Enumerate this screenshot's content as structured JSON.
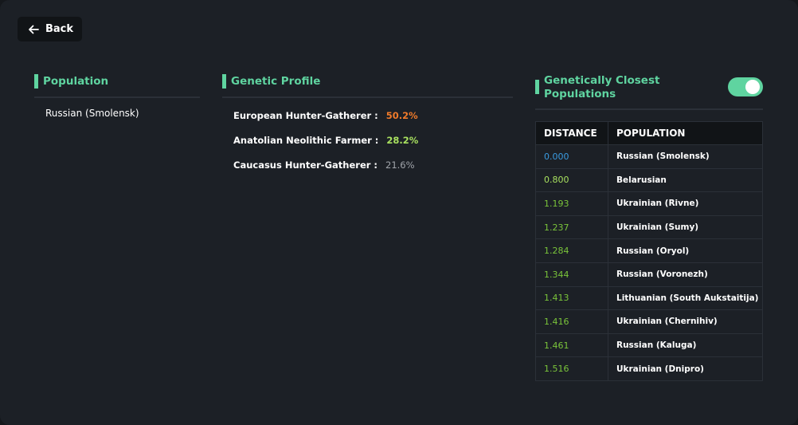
{
  "back_button": {
    "label": "Back",
    "icon": "arrow-left-icon"
  },
  "population_section": {
    "title": "Population",
    "value": "Russian (Smolensk)"
  },
  "genetic_profile": {
    "title": "Genetic Profile",
    "components": [
      {
        "label": "European Hunter-Gatherer :",
        "value": "50.2%",
        "color": "#f07a2a"
      },
      {
        "label": "Anatolian Neolithic Farmer :",
        "value": "28.2%",
        "color": "#a8e05f"
      },
      {
        "label": "Caucasus Hunter-Gatherer :",
        "value": "21.6%",
        "color": "#a0a4aa"
      }
    ]
  },
  "closest_populations": {
    "title": "Genetically Closest Populations",
    "toggle_on": true,
    "columns": [
      "DISTANCE",
      "POPULATION"
    ],
    "rows": [
      {
        "distance": "0.000",
        "population": "Russian (Smolensk)",
        "color": "#3a9be0"
      },
      {
        "distance": "0.800",
        "population": "Belarusian",
        "color": "#a8e05f"
      },
      {
        "distance": "1.193",
        "population": "Ukrainian (Rivne)",
        "color": "#7ac43a"
      },
      {
        "distance": "1.237",
        "population": "Ukrainian (Sumy)",
        "color": "#7ac43a"
      },
      {
        "distance": "1.284",
        "population": "Russian (Oryol)",
        "color": "#7ac43a"
      },
      {
        "distance": "1.344",
        "population": "Russian (Voronezh)",
        "color": "#7ac43a"
      },
      {
        "distance": "1.413",
        "population": "Lithuanian (South Aukstaitija)",
        "color": "#7ac43a"
      },
      {
        "distance": "1.416",
        "population": "Ukrainian (Chernihiv)",
        "color": "#7ac43a"
      },
      {
        "distance": "1.461",
        "population": "Russian (Kaluga)",
        "color": "#7ac43a"
      },
      {
        "distance": "1.516",
        "population": "Ukrainian (Dnipro)",
        "color": "#7ac43a"
      }
    ]
  }
}
